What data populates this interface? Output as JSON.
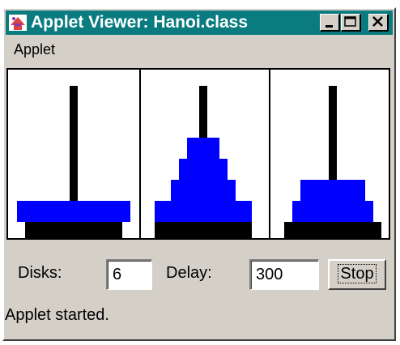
{
  "window": {
    "title": "Applet Viewer: Hanoi.class",
    "titlebar_color": "#0a7c80",
    "buttons": [
      "minimize-icon",
      "maximize-icon",
      "close-icon"
    ]
  },
  "menu": {
    "items": [
      "Applet"
    ]
  },
  "controls": {
    "disks_label": "Disks:",
    "disks_value": "6",
    "delay_label": "Delay:",
    "delay_value": "300",
    "stop_label": "Stop"
  },
  "status": {
    "text": "Applet started."
  },
  "towers": {
    "disk_color": "#0000ff",
    "base_color": "#000000",
    "pegs": [
      {
        "disks": [
          6
        ]
      },
      {
        "disks": [
          5,
          3,
          2,
          1
        ]
      },
      {
        "disks": [
          4,
          3
        ]
      }
    ]
  }
}
